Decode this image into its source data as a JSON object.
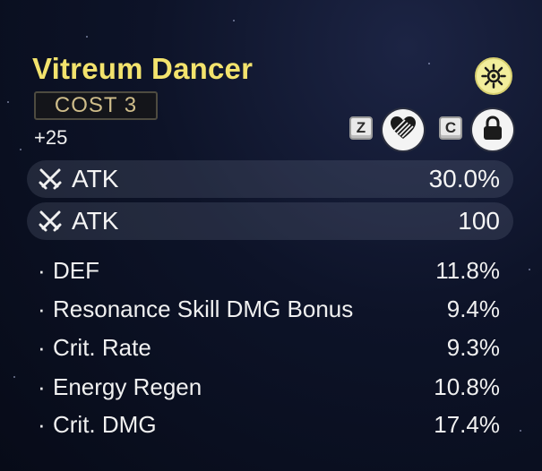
{
  "echo": {
    "name": "Vitreum Dancer",
    "cost_label": "COST  3",
    "level": "+25"
  },
  "icons": {
    "sonata": "sonata-sun-icon",
    "discard": "heart-discard-icon",
    "lock": "lock-icon"
  },
  "keys": {
    "discard": "Z",
    "lock": "C"
  },
  "main_stats": [
    {
      "name": "ATK",
      "value": "30.0%",
      "icon": "sword-cross-icon"
    },
    {
      "name": "ATK",
      "value": "100",
      "icon": "sword-cross-icon"
    }
  ],
  "sub_stats": [
    {
      "bullet": "·",
      "name": "DEF",
      "value": "11.8%"
    },
    {
      "bullet": "·",
      "name": "Resonance Skill DMG Bonus",
      "value": "9.4%"
    },
    {
      "bullet": "·",
      "name": "Crit. Rate",
      "value": "9.3%"
    },
    {
      "bullet": "·",
      "name": "Energy Regen",
      "value": "10.8%"
    },
    {
      "bullet": "·",
      "name": "Crit. DMG",
      "value": "17.4%"
    }
  ],
  "colors": {
    "title": "#f3e36d",
    "cost_text": "#cfbd8a",
    "sonata_badge": "#f2ee9c"
  }
}
